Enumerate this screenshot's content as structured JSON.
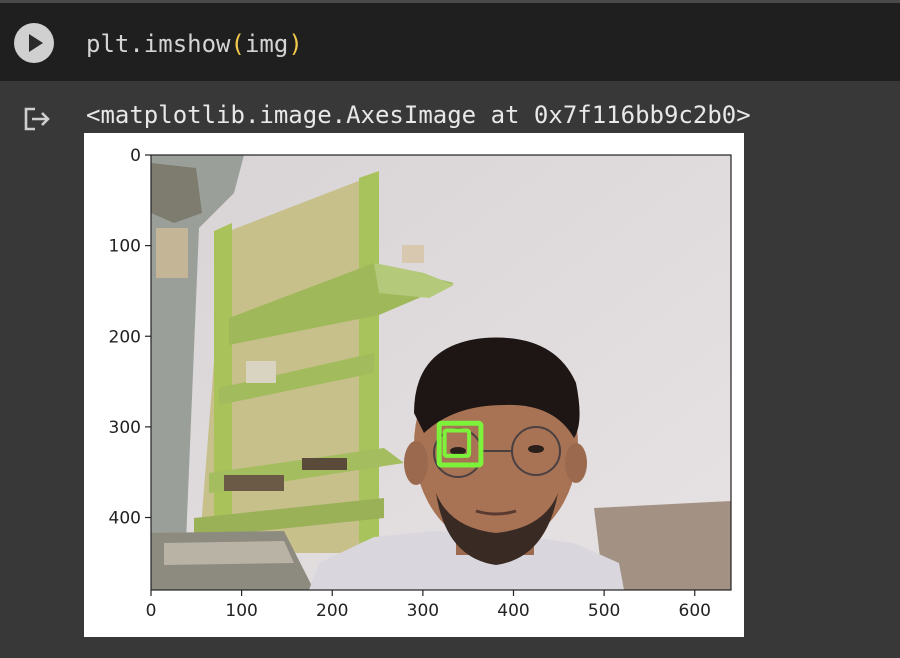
{
  "cell": {
    "code_pre": "plt.imshow",
    "code_open_paren": "(",
    "code_arg": "img",
    "code_close_paren": ")",
    "run_icon": "play-icon",
    "output_icon": "output-redirect-icon",
    "output_text": "<matplotlib.image.AxesImage at 0x7f116bb9c2b0>"
  },
  "colors": {
    "background": "#383838",
    "input_background": "#1f1f1f",
    "paren": "#f2c94c",
    "detection_box": "#7cf23a"
  },
  "chart_data": {
    "type": "image",
    "title": "",
    "xlabel": "",
    "ylabel": "",
    "xlim": [
      0,
      640
    ],
    "ylim": [
      480,
      0
    ],
    "x_ticks": [
      0,
      100,
      200,
      300,
      400,
      500,
      600
    ],
    "y_ticks": [
      0,
      100,
      200,
      300,
      400
    ],
    "annotations": [
      {
        "label": "detected eye box (outer)",
        "x": [
          318,
          364
        ],
        "y": [
          296,
          342
        ]
      },
      {
        "label": "detected eye box (inner)",
        "x": [
          324,
          351
        ],
        "y": [
          304,
          332
        ]
      }
    ]
  }
}
